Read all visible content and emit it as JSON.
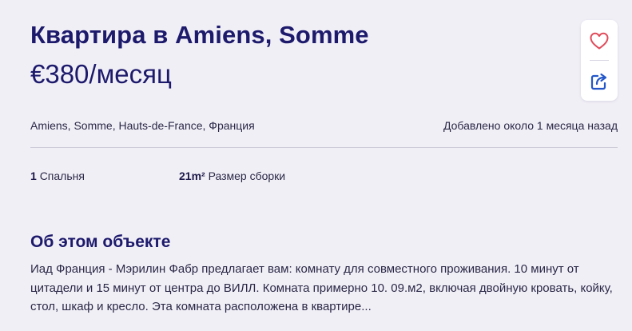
{
  "listing": {
    "title": "Квартира в Amiens, Somme",
    "price": "€380/месяц",
    "location": "Amiens, Somme, Hauts-de-France, Франция",
    "added": "Добавлено около 1 месяца назад"
  },
  "actions": {
    "favorite_icon": "heart-icon",
    "share_icon": "share-icon",
    "accent_color": "#e04b5a",
    "share_color": "#2357c9"
  },
  "features": {
    "bedrooms_value": "1",
    "bedrooms_label": "Спальня",
    "size_value": "21m²",
    "size_label": "Размер сборки"
  },
  "about": {
    "heading": "Об этом объекте",
    "text": "Иад Франция - Мэрилин Фабр предлагает вам: комнату для совместного проживания. 10 минут от цитадели и 15 минут от центра до ВИЛЛ. Комната примерно 10. 09.м2, включая двойную кровать, койку, стол, шкаф и кресло. Эта комната расположена в квартире..."
  }
}
